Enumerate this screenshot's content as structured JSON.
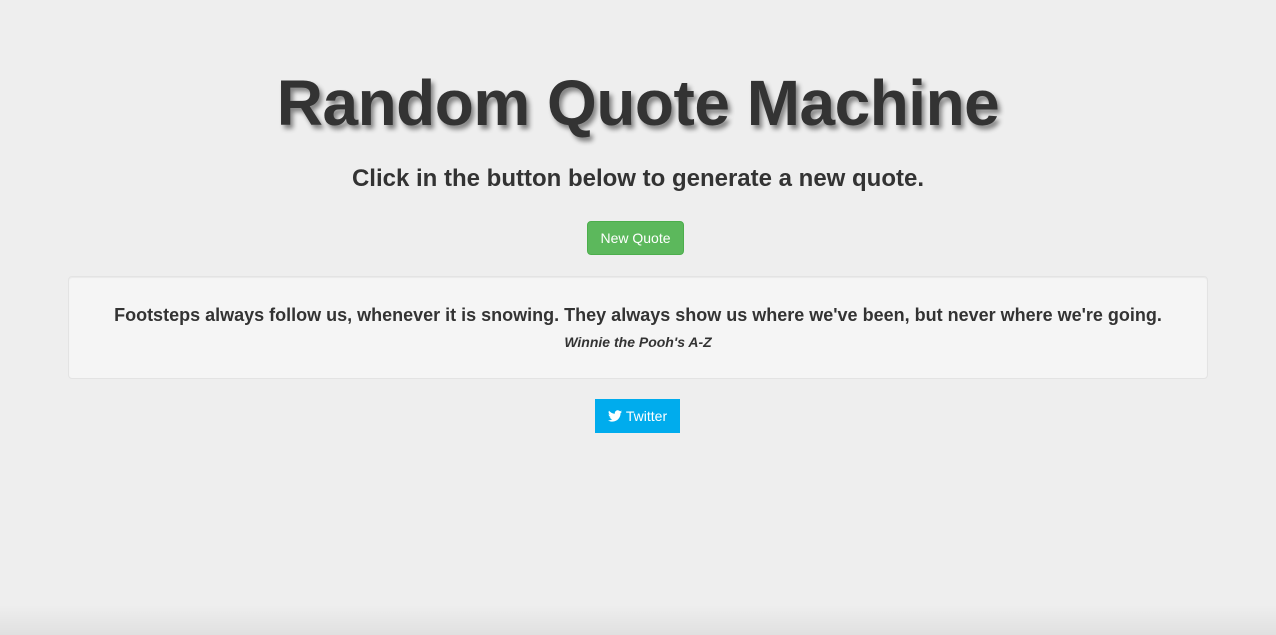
{
  "header": {
    "title": "Random Quote Machine",
    "subtitle": "Click in the button below to generate a new quote."
  },
  "actions": {
    "new_quote_label": "New Quote",
    "twitter_label": "Twitter"
  },
  "quote": {
    "text": "Footsteps always follow us, whenever it is snowing. They always show us where we've been, but never where we're going.",
    "author": "Winnie the Pooh's A-Z"
  },
  "colors": {
    "background": "#eeeeee",
    "new_quote_button": "#5cb85c",
    "twitter_button": "#00aced",
    "quote_box": "#f5f5f5"
  },
  "icons": {
    "twitter": "twitter-bird-icon"
  }
}
